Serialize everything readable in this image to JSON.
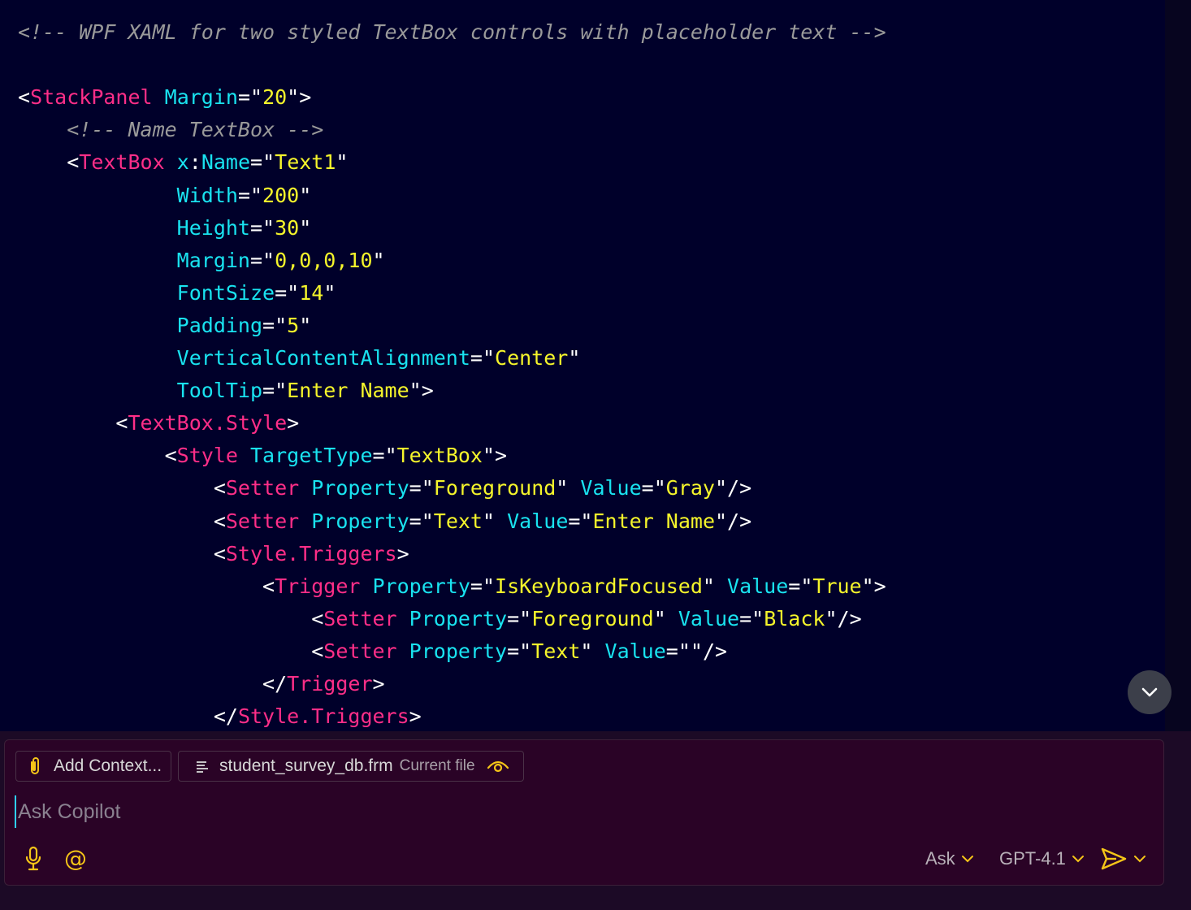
{
  "code": {
    "lines": [
      [
        {
          "t": "<!-- WPF XAML for two styled TextBox controls with placeholder text -->",
          "c": "comment"
        }
      ],
      [],
      [
        {
          "t": "<",
          "c": "punc"
        },
        {
          "t": "StackPanel",
          "c": "tag"
        },
        {
          "t": " ",
          "c": "punc"
        },
        {
          "t": "Margin",
          "c": "attr"
        },
        {
          "t": "=\"",
          "c": "punc"
        },
        {
          "t": "20",
          "c": "str"
        },
        {
          "t": "\">",
          "c": "punc"
        }
      ],
      [
        {
          "t": "    ",
          "c": "punc"
        },
        {
          "t": "<!-- Name TextBox -->",
          "c": "comment"
        }
      ],
      [
        {
          "t": "    <",
          "c": "punc"
        },
        {
          "t": "TextBox",
          "c": "tag"
        },
        {
          "t": " ",
          "c": "punc"
        },
        {
          "t": "x",
          "c": "attr"
        },
        {
          "t": ":",
          "c": "punc"
        },
        {
          "t": "Name",
          "c": "attr"
        },
        {
          "t": "=\"",
          "c": "punc"
        },
        {
          "t": "Text1",
          "c": "str"
        },
        {
          "t": "\"",
          "c": "punc"
        }
      ],
      [
        {
          "t": "             ",
          "c": "punc"
        },
        {
          "t": "Width",
          "c": "attr"
        },
        {
          "t": "=\"",
          "c": "punc"
        },
        {
          "t": "200",
          "c": "str"
        },
        {
          "t": "\"",
          "c": "punc"
        }
      ],
      [
        {
          "t": "             ",
          "c": "punc"
        },
        {
          "t": "Height",
          "c": "attr"
        },
        {
          "t": "=\"",
          "c": "punc"
        },
        {
          "t": "30",
          "c": "str"
        },
        {
          "t": "\"",
          "c": "punc"
        }
      ],
      [
        {
          "t": "             ",
          "c": "punc"
        },
        {
          "t": "Margin",
          "c": "attr"
        },
        {
          "t": "=\"",
          "c": "punc"
        },
        {
          "t": "0,0,0,10",
          "c": "str"
        },
        {
          "t": "\"",
          "c": "punc"
        }
      ],
      [
        {
          "t": "             ",
          "c": "punc"
        },
        {
          "t": "FontSize",
          "c": "attr"
        },
        {
          "t": "=\"",
          "c": "punc"
        },
        {
          "t": "14",
          "c": "str"
        },
        {
          "t": "\"",
          "c": "punc"
        }
      ],
      [
        {
          "t": "             ",
          "c": "punc"
        },
        {
          "t": "Padding",
          "c": "attr"
        },
        {
          "t": "=\"",
          "c": "punc"
        },
        {
          "t": "5",
          "c": "str"
        },
        {
          "t": "\"",
          "c": "punc"
        }
      ],
      [
        {
          "t": "             ",
          "c": "punc"
        },
        {
          "t": "VerticalContentAlignment",
          "c": "attr"
        },
        {
          "t": "=\"",
          "c": "punc"
        },
        {
          "t": "Center",
          "c": "str"
        },
        {
          "t": "\"",
          "c": "punc"
        }
      ],
      [
        {
          "t": "             ",
          "c": "punc"
        },
        {
          "t": "ToolTip",
          "c": "attr"
        },
        {
          "t": "=\"",
          "c": "punc"
        },
        {
          "t": "Enter Name",
          "c": "str"
        },
        {
          "t": "\">",
          "c": "punc"
        }
      ],
      [
        {
          "t": "        <",
          "c": "punc"
        },
        {
          "t": "TextBox.Style",
          "c": "tag"
        },
        {
          "t": ">",
          "c": "punc"
        }
      ],
      [
        {
          "t": "            <",
          "c": "punc"
        },
        {
          "t": "Style",
          "c": "tag"
        },
        {
          "t": " ",
          "c": "punc"
        },
        {
          "t": "TargetType",
          "c": "attr"
        },
        {
          "t": "=\"",
          "c": "punc"
        },
        {
          "t": "TextBox",
          "c": "str"
        },
        {
          "t": "\">",
          "c": "punc"
        }
      ],
      [
        {
          "t": "                <",
          "c": "punc"
        },
        {
          "t": "Setter",
          "c": "tag"
        },
        {
          "t": " ",
          "c": "punc"
        },
        {
          "t": "Property",
          "c": "attr"
        },
        {
          "t": "=\"",
          "c": "punc"
        },
        {
          "t": "Foreground",
          "c": "str"
        },
        {
          "t": "\" ",
          "c": "punc"
        },
        {
          "t": "Value",
          "c": "attr"
        },
        {
          "t": "=\"",
          "c": "punc"
        },
        {
          "t": "Gray",
          "c": "str"
        },
        {
          "t": "\"/>",
          "c": "punc"
        }
      ],
      [
        {
          "t": "                <",
          "c": "punc"
        },
        {
          "t": "Setter",
          "c": "tag"
        },
        {
          "t": " ",
          "c": "punc"
        },
        {
          "t": "Property",
          "c": "attr"
        },
        {
          "t": "=\"",
          "c": "punc"
        },
        {
          "t": "Text",
          "c": "str"
        },
        {
          "t": "\" ",
          "c": "punc"
        },
        {
          "t": "Value",
          "c": "attr"
        },
        {
          "t": "=\"",
          "c": "punc"
        },
        {
          "t": "Enter Name",
          "c": "str"
        },
        {
          "t": "\"/>",
          "c": "punc"
        }
      ],
      [
        {
          "t": "                <",
          "c": "punc"
        },
        {
          "t": "Style.Triggers",
          "c": "tag"
        },
        {
          "t": ">",
          "c": "punc"
        }
      ],
      [
        {
          "t": "                    <",
          "c": "punc"
        },
        {
          "t": "Trigger",
          "c": "tag"
        },
        {
          "t": " ",
          "c": "punc"
        },
        {
          "t": "Property",
          "c": "attr"
        },
        {
          "t": "=\"",
          "c": "punc"
        },
        {
          "t": "IsKeyboardFocused",
          "c": "str"
        },
        {
          "t": "\" ",
          "c": "punc"
        },
        {
          "t": "Value",
          "c": "attr"
        },
        {
          "t": "=\"",
          "c": "punc"
        },
        {
          "t": "True",
          "c": "str"
        },
        {
          "t": "\">",
          "c": "punc"
        }
      ],
      [
        {
          "t": "                        <",
          "c": "punc"
        },
        {
          "t": "Setter",
          "c": "tag"
        },
        {
          "t": " ",
          "c": "punc"
        },
        {
          "t": "Property",
          "c": "attr"
        },
        {
          "t": "=\"",
          "c": "punc"
        },
        {
          "t": "Foreground",
          "c": "str"
        },
        {
          "t": "\" ",
          "c": "punc"
        },
        {
          "t": "Value",
          "c": "attr"
        },
        {
          "t": "=\"",
          "c": "punc"
        },
        {
          "t": "Black",
          "c": "str"
        },
        {
          "t": "\"/>",
          "c": "punc"
        }
      ],
      [
        {
          "t": "                        <",
          "c": "punc"
        },
        {
          "t": "Setter",
          "c": "tag"
        },
        {
          "t": " ",
          "c": "punc"
        },
        {
          "t": "Property",
          "c": "attr"
        },
        {
          "t": "=\"",
          "c": "punc"
        },
        {
          "t": "Text",
          "c": "str"
        },
        {
          "t": "\" ",
          "c": "punc"
        },
        {
          "t": "Value",
          "c": "attr"
        },
        {
          "t": "=\"\"/>",
          "c": "punc"
        }
      ],
      [
        {
          "t": "                    </",
          "c": "punc"
        },
        {
          "t": "Trigger",
          "c": "tag"
        },
        {
          "t": ">",
          "c": "punc"
        }
      ],
      [
        {
          "t": "                </",
          "c": "punc"
        },
        {
          "t": "Style.Triggers",
          "c": "tag"
        },
        {
          "t": ">",
          "c": "punc"
        }
      ]
    ]
  },
  "scroll_button": {
    "icon": "chevron-down-icon"
  },
  "chat": {
    "add_context_label": "Add Context...",
    "add_context_icon": "paperclip-icon",
    "file_name": "student_survey_db.frm",
    "file_badge": "Current file",
    "file_icon": "file-lines-icon",
    "visibility_icon": "eye-icon",
    "input_placeholder": "Ask Copilot",
    "input_value": "",
    "mic_icon": "microphone-icon",
    "mention_symbol": "@",
    "mode_label": "Ask",
    "model_label": "GPT-4.1",
    "send_icon": "send-icon"
  },
  "colors": {
    "code_bg": "#00002a",
    "chat_bg": "#2a0326",
    "tag": "#ff2e88",
    "attribute": "#19e3f0",
    "string": "#f5f52b",
    "comment": "#9a9a9a",
    "accent_icon": "#f5c518"
  }
}
